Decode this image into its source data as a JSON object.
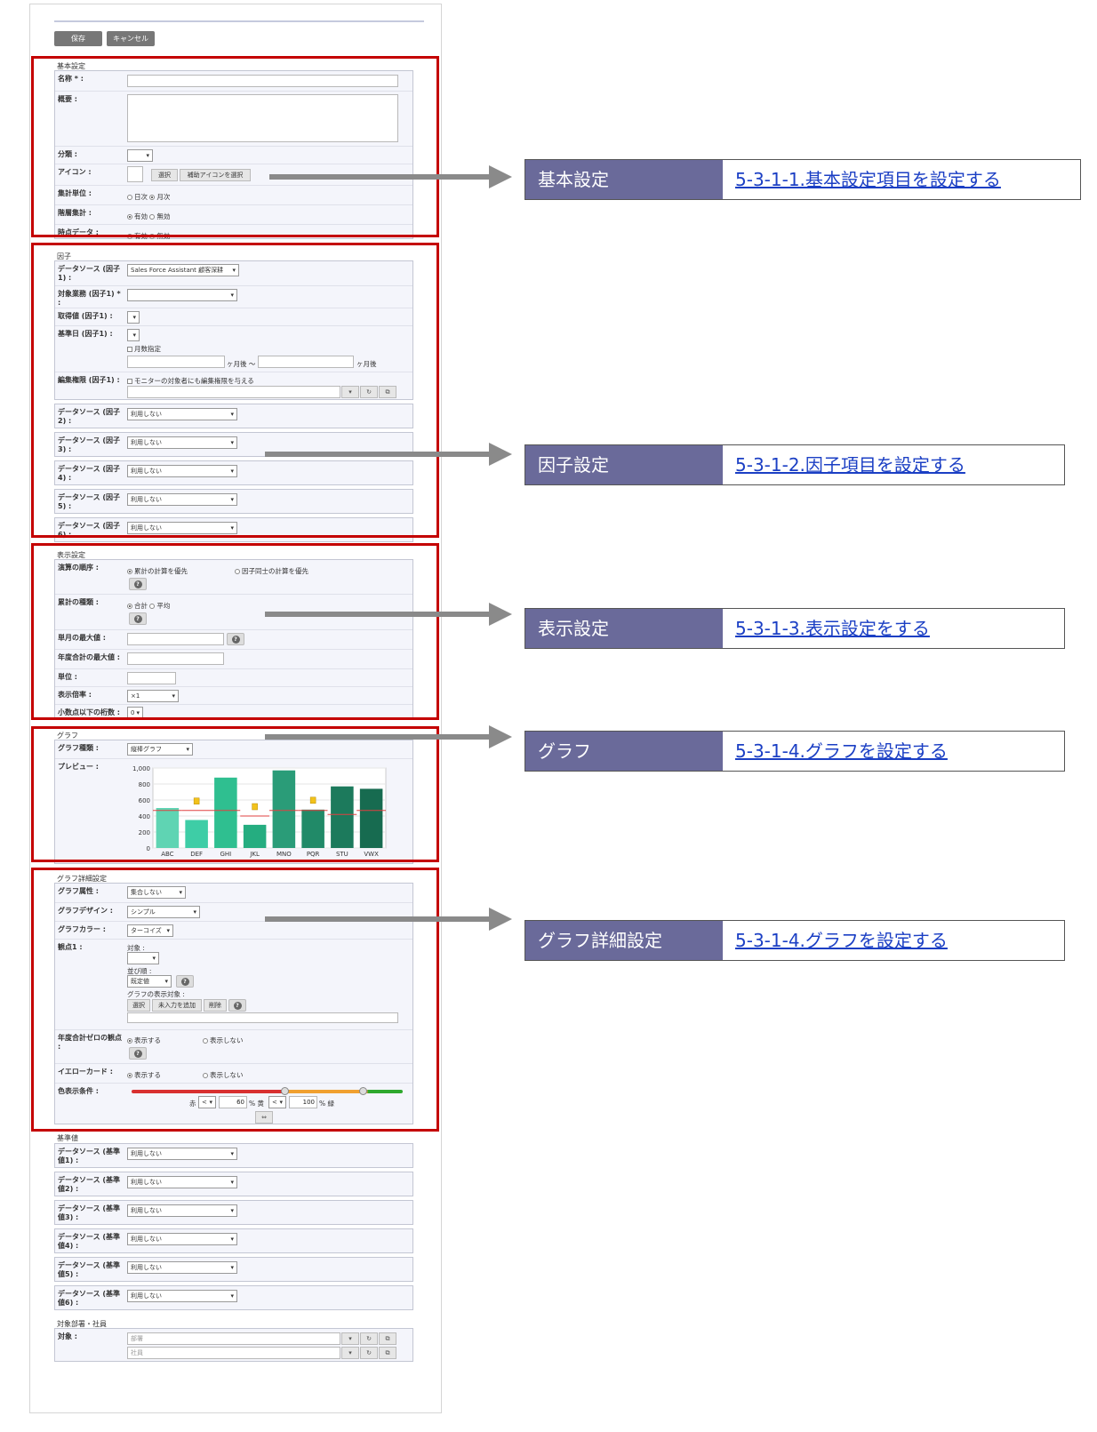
{
  "toolbar": {
    "save": "保存",
    "cancel": "キャンセル"
  },
  "basic": {
    "title": "基本設定",
    "name_label": "名称 * :",
    "summary_label": "概要 :",
    "category_label": "分類 :",
    "icon_label": "アイコン :",
    "icon_select": "選択",
    "icon_aux": "補助アイコンを選択",
    "unit_label": "集計単位 :",
    "unit_opts": [
      "日次",
      "月次"
    ],
    "hier_label": "階層集計 :",
    "hier_opts": [
      "有効",
      "無効"
    ],
    "point_label": "時点データ :",
    "point_opts": [
      "有効",
      "無効"
    ]
  },
  "factor": {
    "title": "因子",
    "ds1_label": "データソース (因子1) :",
    "ds1_value": "Sales Force Assistant 顧客深耕",
    "biz_label": "対象業務 (因子1) * :",
    "get_label": "取得値 (因子1) :",
    "base_label": "基準日 (因子1) :",
    "months_chk": "月数指定",
    "months_after": "ヶ月後 〜",
    "months_after2": "ヶ月後",
    "edit_label": "編集権限 (因子1) :",
    "edit_chk": "モニターの対象者にも編集権限を与える",
    "sources": [
      {
        "label": "データソース (因子2) :",
        "value": "利用しない"
      },
      {
        "label": "データソース (因子3) :",
        "value": "利用しない"
      },
      {
        "label": "データソース (因子4) :",
        "value": "利用しない"
      },
      {
        "label": "データソース (因子5) :",
        "value": "利用しない"
      },
      {
        "label": "データソース (因子6) :",
        "value": "利用しない"
      }
    ]
  },
  "display": {
    "title": "表示設定",
    "order_label": "演算の順序 :",
    "order_opts": [
      "累計の計算を優先",
      "因子同士の計算を優先"
    ],
    "kind_label": "累計の種類 :",
    "kind_opts": [
      "合計",
      "平均"
    ],
    "monthmax_label": "単月の最大値 :",
    "yearmax_label": "年度合計の最大値 :",
    "unit_label": "単位 :",
    "scale_label": "表示倍率 :",
    "scale_value": "×1",
    "decimal_label": "小数点以下の桁数 :",
    "decimal_value": "0"
  },
  "graph": {
    "title": "グラフ",
    "type_label": "グラフ種類 :",
    "type_value": "縦棒グラフ",
    "preview_label": "プレビュー :"
  },
  "chart_data": {
    "type": "bar",
    "categories": [
      "ABC",
      "DEF",
      "GHI",
      "JKL",
      "MNO",
      "PQR",
      "STU",
      "VWX"
    ],
    "values": [
      500,
      350,
      880,
      290,
      970,
      480,
      770,
      740
    ],
    "ref_line": [
      470,
      470,
      470,
      400,
      470,
      470,
      420,
      470
    ],
    "ylim": [
      0,
      1000
    ],
    "yticks": [
      "0",
      "200",
      "400",
      "600",
      "800",
      "1,000"
    ],
    "colors": [
      "#5fd4b3",
      "#3ecda6",
      "#2fbf90",
      "#25ad80",
      "#2a9c78",
      "#218a68",
      "#1c7a5c",
      "#176b50"
    ],
    "ref_color": "#e04040"
  },
  "detail": {
    "title": "グラフ詳細設定",
    "attr_label": "グラフ属性 :",
    "attr_value": "集合しない",
    "design_label": "グラフデザイン :",
    "design_value": "シンプル",
    "color_label": "グラフカラー :",
    "color_value": "ターコイズ",
    "view_label": "観点1 :",
    "target_label": "対象 :",
    "sort_label": "並び順 :",
    "sort_value": "既定値",
    "show_target_label": "グラフの表示対象 :",
    "btn_select": "選択",
    "btn_add": "未入力を追加",
    "btn_del": "削除",
    "zero_label": "年度合計ゼロの観点 :",
    "zero_opts": [
      "表示する",
      "表示しない"
    ],
    "yellow_label": "イエローカード :",
    "yellow_opts": [
      "表示する",
      "表示しない"
    ],
    "cond_label": "色表示条件 :",
    "red": "赤",
    "lt": "<",
    "v1": "60",
    "pct_yellow": "% 黄",
    "v2": "100",
    "pct_green": "% 緑"
  },
  "baseline": {
    "title": "基準値",
    "sources": [
      {
        "label": "データソース (基準値1) :",
        "value": "利用しない"
      },
      {
        "label": "データソース (基準値2) :",
        "value": "利用しない"
      },
      {
        "label": "データソース (基準値3) :",
        "value": "利用しない"
      },
      {
        "label": "データソース (基準値4) :",
        "value": "利用しない"
      },
      {
        "label": "データソース (基準値5) :",
        "value": "利用しない"
      },
      {
        "label": "データソース (基準値6) :",
        "value": "利用しない"
      }
    ]
  },
  "target": {
    "title": "対象部署・社員",
    "label": "対象 :",
    "dept_ph": "部署",
    "emp_ph": "社員"
  },
  "callouts": [
    {
      "head": "基本設定",
      "link": "5-3-1-1.基本設定項目を設定する"
    },
    {
      "head": "因子設定",
      "link": "5-3-1-2.因子項目を設定する"
    },
    {
      "head": "表示設定",
      "link": "5-3-1-3.表示設定をする"
    },
    {
      "head": "グラフ",
      "link": "5-3-1-4.グラフを設定する"
    },
    {
      "head": "グラフ詳細設定",
      "link": "5-3-1-4.グラフを設定する"
    }
  ]
}
